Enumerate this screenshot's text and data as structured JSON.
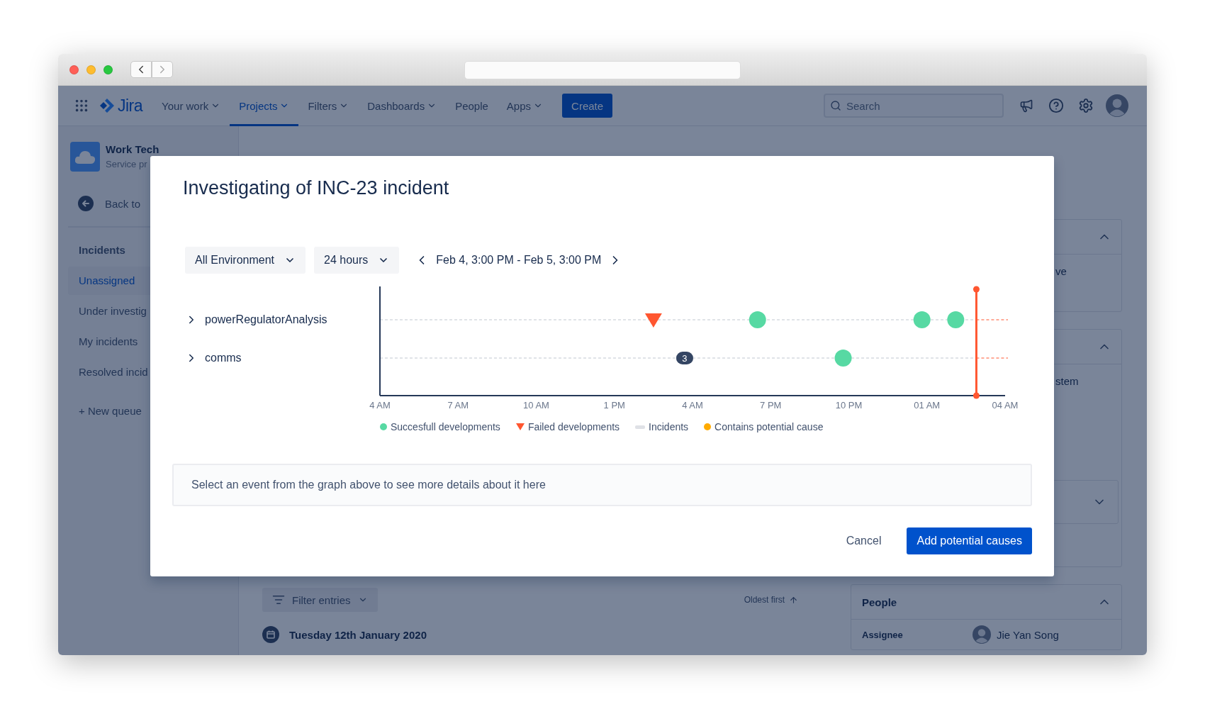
{
  "nav": {
    "logo": "Jira",
    "items": [
      {
        "label": "Your work",
        "dropdown": true,
        "selected": false
      },
      {
        "label": "Projects",
        "dropdown": true,
        "selected": true
      },
      {
        "label": "Filters",
        "dropdown": true,
        "selected": false
      },
      {
        "label": "Dashboards",
        "dropdown": true,
        "selected": false
      },
      {
        "label": "People",
        "dropdown": false,
        "selected": false
      },
      {
        "label": "Apps",
        "dropdown": true,
        "selected": false
      }
    ],
    "create_button": "Create",
    "search": {
      "placeholder": "Search"
    }
  },
  "sidebar": {
    "project": {
      "name": "Work Tech",
      "subtitle": "Service pr"
    },
    "back_link": "Back to",
    "section_title": "Incidents",
    "queues": [
      {
        "label": "Unassigned",
        "selected": true
      },
      {
        "label": "Under investig",
        "selected": false
      },
      {
        "label": "My incidents",
        "selected": false
      },
      {
        "label": "Resolved incid",
        "selected": false
      }
    ],
    "new_queue": "+ New queue"
  },
  "main": {
    "filter_button": "Filter entries",
    "sort": "Oldest first",
    "date_heading": "Tuesday 12th January 2020"
  },
  "right_panels": [
    {
      "text": "ve",
      "expanded": true
    },
    {
      "text": "stem",
      "expanded": true,
      "select": {
        "open": false
      }
    }
  ],
  "people_panel": {
    "title": "People",
    "expanded": true,
    "fields": [
      {
        "label": "Assignee",
        "value": "Jie Yan Song"
      }
    ]
  },
  "modal": {
    "title": "Investigating of INC-23 incident",
    "filters": [
      {
        "label": "All Environment"
      },
      {
        "label": "24 hours"
      }
    ],
    "range": "Feb 4, 3:00 PM - Feb 5, 3:00 PM",
    "services": [
      {
        "label": "powerRegulatorAnalysis",
        "expanded": false
      },
      {
        "label": "comms",
        "expanded": false
      }
    ],
    "timeline": {
      "axis_labels": [
        "4 AM",
        "7 AM",
        "10 AM",
        "1 PM",
        "4 AM",
        "7 PM",
        "10 PM",
        "01 AM",
        "04 AM"
      ],
      "cluster_badge": "3",
      "legend": [
        {
          "name": "Succesfull developments",
          "color": "#57d9a3",
          "kind": "circle"
        },
        {
          "name": "Failed developments",
          "color": "#ff5630",
          "kind": "triangle"
        },
        {
          "name": "Incidents",
          "color": "#dfe1e6",
          "kind": "bar"
        },
        {
          "name": "Contains potential cause",
          "color": "#ffab00",
          "kind": "circle"
        }
      ]
    },
    "details_placeholder": "Select an event from the graph above to see more details about it here",
    "buttons": [
      {
        "label": "Cancel",
        "kind": "subtle"
      },
      {
        "label": "Add potential causes",
        "kind": "primary"
      }
    ]
  }
}
